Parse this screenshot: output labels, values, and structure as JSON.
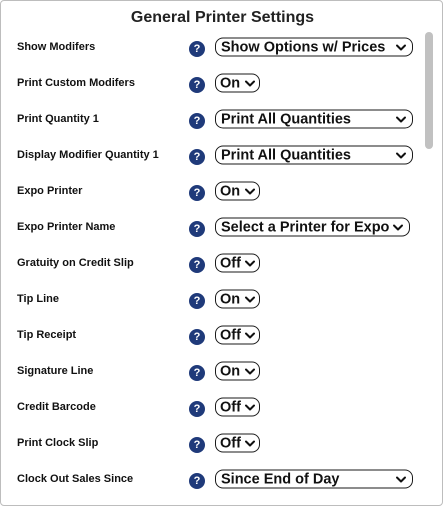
{
  "title": "General Printer Settings",
  "help_glyph": "?",
  "rows": [
    {
      "label": "Show Modifers",
      "value": "Show Options w/ Prices"
    },
    {
      "label": "Print Custom Modifers",
      "value": "On"
    },
    {
      "label": "Print Quantity 1",
      "value": "Print All Quantities"
    },
    {
      "label": "Display Modifier Quantity 1",
      "value": "Print All Quantities"
    },
    {
      "label": "Expo Printer",
      "value": "On"
    },
    {
      "label": "Expo Printer Name",
      "value": "Select a Printer for Expo"
    },
    {
      "label": "Gratuity on Credit Slip",
      "value": "Off"
    },
    {
      "label": "Tip Line",
      "value": "On"
    },
    {
      "label": "Tip Receipt",
      "value": "Off"
    },
    {
      "label": "Signature Line",
      "value": "On"
    },
    {
      "label": "Credit Barcode",
      "value": "Off"
    },
    {
      "label": "Print Clock Slip",
      "value": "Off"
    },
    {
      "label": "Clock Out Sales Since",
      "value": "Since End of Day"
    }
  ],
  "colors": {
    "help_icon": "#1f3a7a",
    "border": "#1a1a1a",
    "scrollbar_thumb": "#c1c1c1"
  },
  "icons": {
    "help": "question-circle-icon",
    "dropdown": "chevron-down-icon"
  }
}
